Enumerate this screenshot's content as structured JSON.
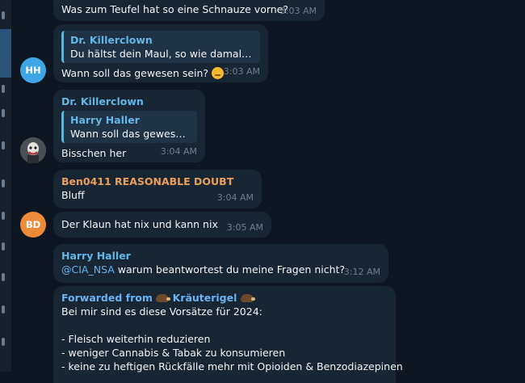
{
  "messages": [
    {
      "text": "Was zum Teufel hat so eine Schnauze vorne?",
      "time": "3:03 AM"
    },
    {
      "quote_name": "Dr. Killerclown",
      "quote_text": "Du hältst dein Maul, so wie damals",
      "text": "Wann soll das gewesen sein?",
      "time": "3:03 AM",
      "avatar_initials": "HH"
    },
    {
      "name": "Dr. Killerclown",
      "quote_name": "Harry Haller",
      "quote_text": "Wann soll das gewese...",
      "text": "Bisschen her",
      "time": "3:04 AM"
    },
    {
      "name": "Ben0411 REASONABLE DOUBT",
      "text": "Bluff",
      "time": "3:04 AM"
    },
    {
      "text": "Der Klaun hat nix und kann nix",
      "time": "3:05 AM",
      "avatar_initials": "BD"
    },
    {
      "name": "Harry Haller",
      "mention": "@CIA_NSA",
      "text": " warum beantwortest du meine Fragen nicht?",
      "time": "3:12 AM"
    },
    {
      "forwarded_label": "Forwarded from",
      "forwarded_name": "Kräuterigel",
      "lines": [
        "Bei mir sind es diese Vorsätze für 2024:",
        "",
        "- Fleisch weiterhin reduzieren",
        "- weniger Cannabis & Tabak zu konsumieren",
        "- keine zu heftigen Rückfälle mehr mit Opioiden & Benzodiazepinen"
      ]
    }
  ],
  "colors": {
    "bg": "#0e1621",
    "bubble": "#182533",
    "blue_name": "#64b5e8",
    "orange_name": "#e8a05a"
  }
}
